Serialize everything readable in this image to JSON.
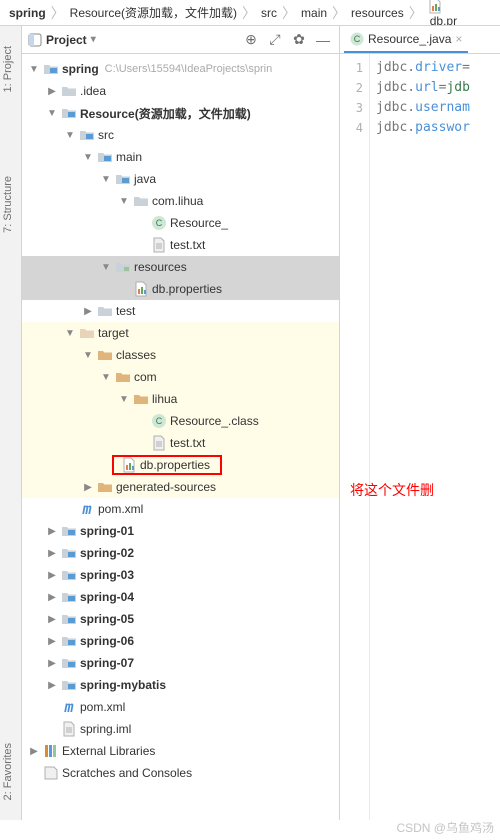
{
  "breadcrumb": [
    "spring",
    "Resource(资源加载，文件加载)",
    "src",
    "main",
    "resources",
    "db.pr"
  ],
  "pane_title": "Project",
  "side_tabs": {
    "project": "1: Project",
    "structure": "7: Structure",
    "favorites": "2: Favorites"
  },
  "editor_tab": "Resource_.java",
  "gutter_lines": [
    "1",
    "2",
    "3",
    "4"
  ],
  "code_lines": [
    {
      "pre": "jdbc.",
      "kw": "driver",
      "post": "="
    },
    {
      "pre": "jdbc.",
      "kw": "url",
      "post": "=",
      "gr": "jdb"
    },
    {
      "pre": "jdbc.",
      "kw": "usernam",
      "post": ""
    },
    {
      "pre": "jdbc.",
      "kw": "passwor",
      "post": ""
    }
  ],
  "annotation_text": "将这个文件删",
  "watermark": "CSDN @乌鱼鸡汤",
  "tree": [
    {
      "indent": 0,
      "arrow": "▼",
      "icon": "folder-blue",
      "label": "spring",
      "bold": true,
      "path": "C:\\Users\\15594\\IdeaProjects\\sprin"
    },
    {
      "indent": 1,
      "arrow": "▶",
      "icon": "folder",
      "label": ".idea"
    },
    {
      "indent": 1,
      "arrow": "▼",
      "icon": "folder-blue",
      "label": "Resource(资源加载，文件加载)",
      "bold": true
    },
    {
      "indent": 2,
      "arrow": "▼",
      "icon": "folder-blue",
      "label": "src"
    },
    {
      "indent": 3,
      "arrow": "▼",
      "icon": "folder-blue",
      "label": "main"
    },
    {
      "indent": 4,
      "arrow": "▼",
      "icon": "folder-blue",
      "label": "java"
    },
    {
      "indent": 5,
      "arrow": "▼",
      "icon": "folder",
      "label": "com.lihua"
    },
    {
      "indent": 6,
      "arrow": "",
      "icon": "java",
      "label": "Resource_"
    },
    {
      "indent": 6,
      "arrow": "",
      "icon": "file",
      "label": "test.txt"
    },
    {
      "indent": 4,
      "arrow": "▼",
      "icon": "res",
      "label": "resources",
      "sel": true
    },
    {
      "indent": 5,
      "arrow": "",
      "icon": "props",
      "label": "db.properties",
      "sel": true
    },
    {
      "indent": 3,
      "arrow": "▶",
      "icon": "folder",
      "label": "test"
    },
    {
      "indent": 2,
      "arrow": "▼",
      "icon": "folder-orange",
      "label": "target",
      "hi": true
    },
    {
      "indent": 3,
      "arrow": "▼",
      "icon": "folder-orange-dark",
      "label": "classes",
      "hi": true
    },
    {
      "indent": 4,
      "arrow": "▼",
      "icon": "folder-orange-dark",
      "label": "com",
      "hi": true
    },
    {
      "indent": 5,
      "arrow": "▼",
      "icon": "folder-orange-dark",
      "label": "lihua",
      "hi": true
    },
    {
      "indent": 6,
      "arrow": "",
      "icon": "java",
      "label": "Resource_.class",
      "hi": true
    },
    {
      "indent": 6,
      "arrow": "",
      "icon": "file",
      "label": "test.txt",
      "hi": true
    },
    {
      "indent": 4,
      "arrow": "",
      "icon": "props",
      "label": "db.properties",
      "hi": true,
      "red": true
    },
    {
      "indent": 3,
      "arrow": "▶",
      "icon": "folder-orange-dark",
      "label": "generated-sources",
      "hi": true
    },
    {
      "indent": 2,
      "arrow": "",
      "icon": "m",
      "label": "pom.xml"
    },
    {
      "indent": 1,
      "arrow": "▶",
      "icon": "folder-blue",
      "label": "spring-01",
      "bold": true
    },
    {
      "indent": 1,
      "arrow": "▶",
      "icon": "folder-blue",
      "label": "spring-02",
      "bold": true
    },
    {
      "indent": 1,
      "arrow": "▶",
      "icon": "folder-blue",
      "label": "spring-03",
      "bold": true
    },
    {
      "indent": 1,
      "arrow": "▶",
      "icon": "folder-blue",
      "label": "spring-04",
      "bold": true
    },
    {
      "indent": 1,
      "arrow": "▶",
      "icon": "folder-blue",
      "label": "spring-05",
      "bold": true
    },
    {
      "indent": 1,
      "arrow": "▶",
      "icon": "folder-blue",
      "label": "spring-06",
      "bold": true
    },
    {
      "indent": 1,
      "arrow": "▶",
      "icon": "folder-blue",
      "label": "spring-07",
      "bold": true
    },
    {
      "indent": 1,
      "arrow": "▶",
      "icon": "folder-blue",
      "label": "spring-mybatis",
      "bold": true
    },
    {
      "indent": 1,
      "arrow": "",
      "icon": "m",
      "label": "pom.xml"
    },
    {
      "indent": 1,
      "arrow": "",
      "icon": "file",
      "label": "spring.iml"
    },
    {
      "indent": 0,
      "arrow": "▶",
      "icon": "lib",
      "label": "External Libraries"
    },
    {
      "indent": 0,
      "arrow": "",
      "icon": "scratch",
      "label": "Scratches and Consoles"
    }
  ]
}
